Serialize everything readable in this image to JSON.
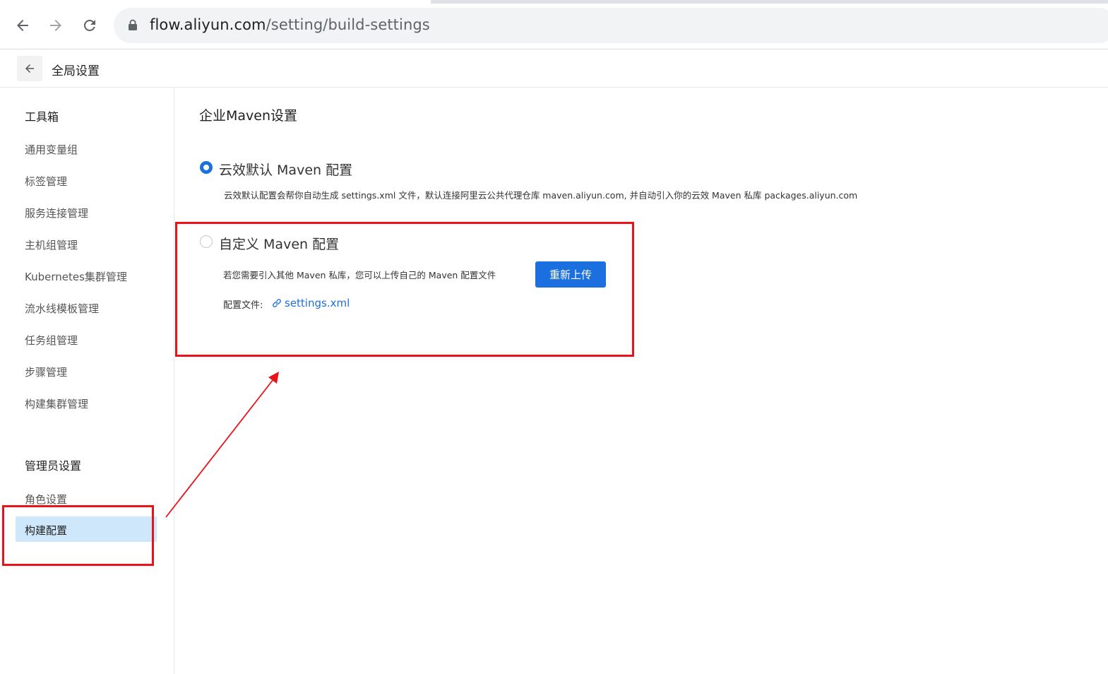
{
  "browser": {
    "url_host": "flow.aliyun.com",
    "url_path": "/setting/build-settings"
  },
  "header": {
    "title": "全局设置"
  },
  "sidebar": {
    "toolbox_heading": "工具箱",
    "toolbox_items": [
      "通用变量组",
      "标签管理",
      "服务连接管理",
      "主机组管理",
      "Kubernetes集群管理",
      "流水线模板管理",
      "任务组管理",
      "步骤管理",
      "构建集群管理"
    ],
    "admin_heading": "管理员设置",
    "admin_items": [
      "角色设置",
      "构建配置"
    ],
    "active_item": "构建配置"
  },
  "main": {
    "title": "企业Maven设置",
    "option_default": {
      "label": "云效默认 Maven 配置",
      "description": "云效默认配置会帮你自动生成 settings.xml 文件，默认连接阿里云公共代理仓库 maven.aliyun.com, 并自动引入你的云效 Maven 私库 packages.aliyun.com",
      "selected": true
    },
    "option_custom": {
      "label": "自定义 Maven 配置",
      "description": "若您需要引入其他 Maven 私库，您可以上传自己的 Maven 配置文件",
      "upload_button": "重新上传",
      "file_label": "配置文件:",
      "file_name": "settings.xml",
      "selected": false
    }
  },
  "colors": {
    "accent": "#1b6fde",
    "active_bg": "#cfe7fb",
    "annotation": "#e8141a"
  }
}
